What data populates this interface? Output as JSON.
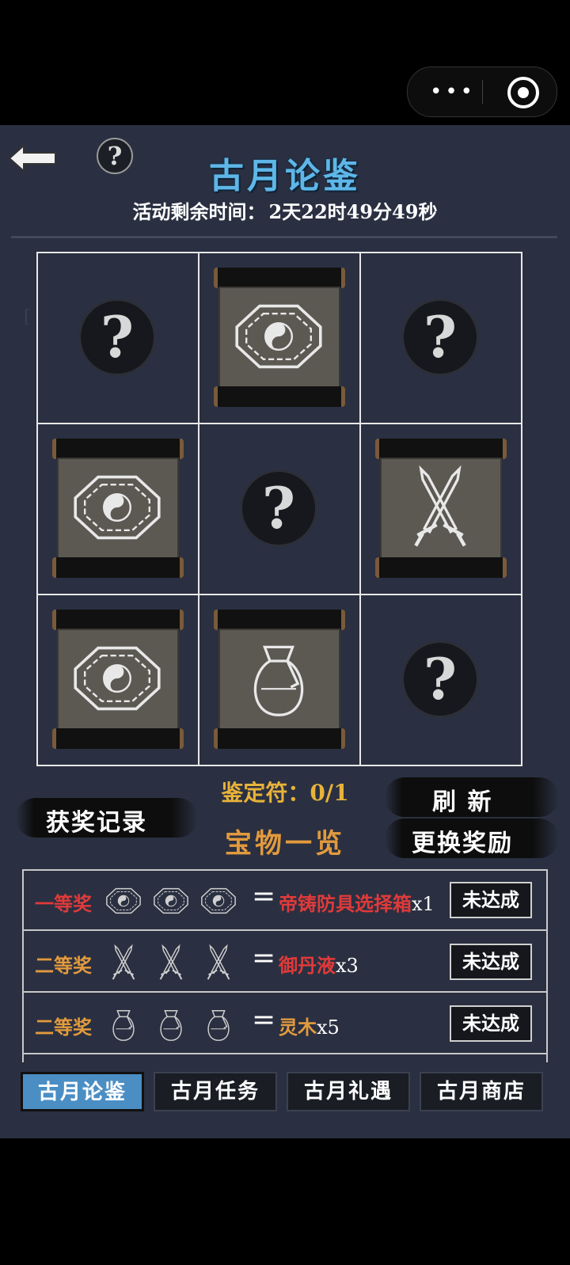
{
  "title": "古月论鉴",
  "timer": {
    "label": "活动剩余时间：",
    "value": "2天22时49分49秒"
  },
  "grid": [
    {
      "state": "hidden",
      "icon": "question-icon"
    },
    {
      "state": "revealed",
      "icon": "bagua-icon"
    },
    {
      "state": "hidden",
      "icon": "question-icon"
    },
    {
      "state": "revealed",
      "icon": "bagua-icon"
    },
    {
      "state": "hidden",
      "icon": "question-icon"
    },
    {
      "state": "revealed",
      "icon": "swords-icon"
    },
    {
      "state": "revealed",
      "icon": "bagua-icon"
    },
    {
      "state": "revealed",
      "icon": "bag-icon"
    },
    {
      "state": "hidden",
      "icon": "question-icon"
    }
  ],
  "question_mark": "?",
  "identify_token": {
    "label": "鉴定符：",
    "value": "0/1"
  },
  "buttons": {
    "award_record": "获奖记录",
    "refresh": "刷 新",
    "change_reward": "更换奖励",
    "treasure_list": "宝物一览"
  },
  "rewards": [
    {
      "rank": "一等奖",
      "rank_color": "#e03a3a",
      "icon": "bagua-icon",
      "prize": "帝铸防具选择箱",
      "prize_color": "#e03a3a",
      "qty": "x1",
      "status": "未达成"
    },
    {
      "rank": "二等奖",
      "rank_color": "#e29a3d",
      "icon": "swords-icon",
      "prize": "御丹液",
      "prize_color": "#e03a3a",
      "qty": "x3",
      "status": "未达成"
    },
    {
      "rank": "二等奖",
      "rank_color": "#e29a3d",
      "icon": "bag-icon",
      "prize": "灵木",
      "prize_color": "#e29a3d",
      "qty": "x5",
      "status": "未达成"
    }
  ],
  "equals": "=",
  "tabs": [
    {
      "label": "古月论鉴",
      "active": true
    },
    {
      "label": "古月任务",
      "active": false
    },
    {
      "label": "古月礼遇",
      "active": false
    },
    {
      "label": "古月商店",
      "active": false
    }
  ],
  "capsule": {
    "menu_icon": "more-dots-icon",
    "close_icon": "target-icon"
  }
}
